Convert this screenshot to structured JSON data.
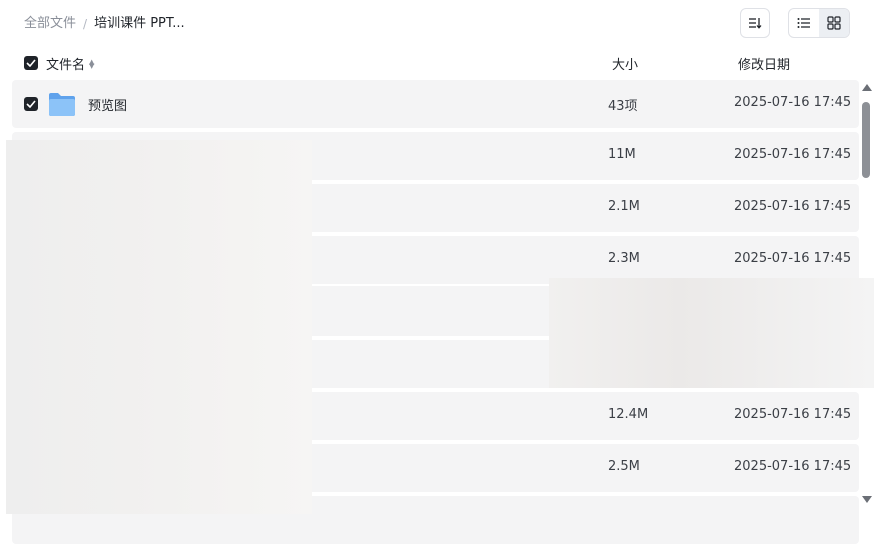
{
  "breadcrumb": {
    "root": "全部文件",
    "separator": "/",
    "current": "培训课件 PPT..."
  },
  "toolbar": {
    "sort_icon": "sort-icon",
    "list_view_icon": "list-view-icon",
    "grid_view_icon": "grid-view-icon",
    "active_view": "list"
  },
  "table": {
    "header": {
      "name": "文件名",
      "size": "大小",
      "date": "修改日期"
    },
    "rows": [
      {
        "name": "预览图",
        "size": "43项",
        "date": "2025-07-16 17:45",
        "type": "folder",
        "checked": true
      },
      {
        "name": "",
        "size": "11M",
        "date": "2025-07-16 17:45"
      },
      {
        "name": "",
        "size": "2.1M",
        "date": "2025-07-16 17:45"
      },
      {
        "name": "",
        "size": "2.3M",
        "date": "2025-07-16 17:45"
      },
      {
        "name": "",
        "size": "",
        "date": ""
      },
      {
        "name": "",
        "size": "",
        "date": ""
      },
      {
        "name": "",
        "size": "12.4M",
        "date": "2025-07-16 17:45"
      },
      {
        "name": "",
        "size": "2.5M",
        "date": "2025-07-16 17:45"
      },
      {
        "name": "",
        "size": "",
        "date": ""
      }
    ]
  },
  "colors": {
    "row_background": "#f4f4f5",
    "checkbox": "#1f2329",
    "folder": "#7ab6f5"
  }
}
